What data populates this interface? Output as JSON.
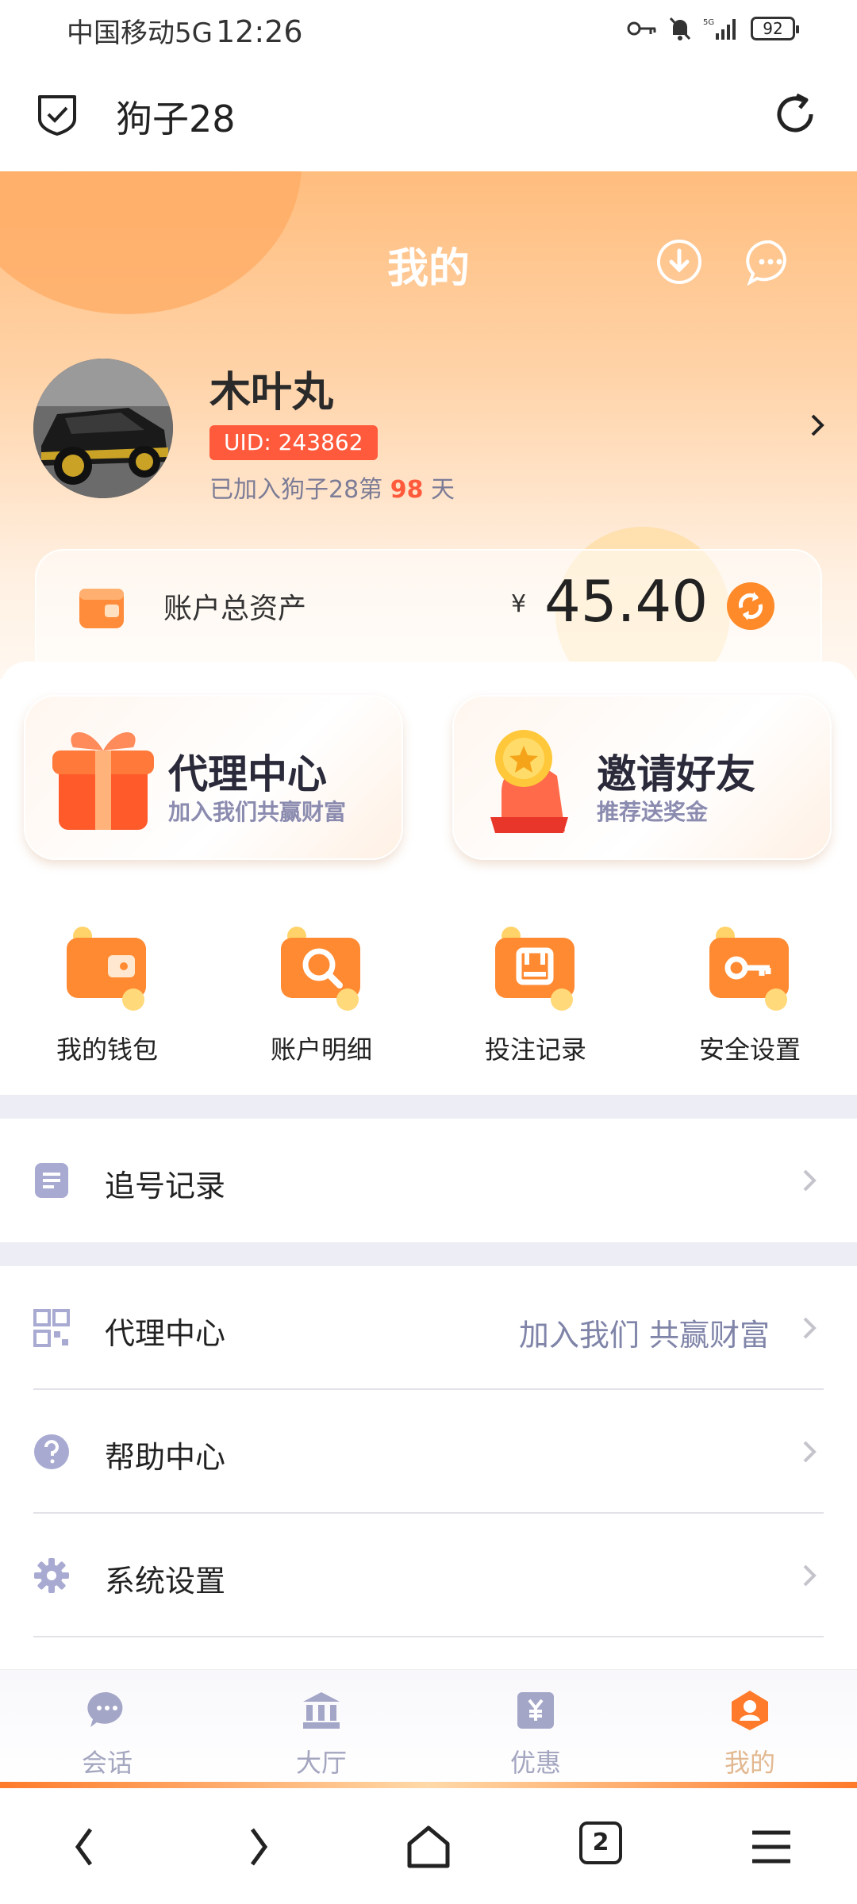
{
  "status_bar": {
    "carrier": "中国移动5G",
    "time": "12:26",
    "battery": "92"
  },
  "app_bar": {
    "title": "狗子28"
  },
  "header": {
    "title": "我的"
  },
  "profile": {
    "name": "木叶丸",
    "uid": "UID: 243862",
    "joined_prefix": "已加入狗子28第",
    "joined_days": "98",
    "joined_suffix": "天"
  },
  "assets": {
    "label": "账户总资产",
    "currency": "¥",
    "amount": "45.40"
  },
  "promos": [
    {
      "title": "代理中心",
      "subtitle": "加入我们共赢财富",
      "icon": "gift-box-icon"
    },
    {
      "title": "邀请好友",
      "subtitle": "推荐送奖金",
      "icon": "coin-hand-icon"
    }
  ],
  "quick_actions": [
    {
      "label": "我的钱包",
      "icon": "wallet-icon"
    },
    {
      "label": "账户明细",
      "icon": "magnifier-icon"
    },
    {
      "label": "投注记录",
      "icon": "record-icon"
    },
    {
      "label": "安全设置",
      "icon": "key-icon"
    }
  ],
  "menu": {
    "chase_records": {
      "label": "追号记录",
      "icon": "document-icon"
    },
    "agent_center": {
      "label": "代理中心",
      "extra": "加入我们 共赢财富",
      "icon": "qr-code-icon"
    },
    "help_center": {
      "label": "帮助中心",
      "icon": "question-icon"
    },
    "system_settings": {
      "label": "系统设置",
      "icon": "gear-icon"
    }
  },
  "tabbar": [
    {
      "label": "会话",
      "icon": "chat-bubble-icon",
      "active": false
    },
    {
      "label": "大厅",
      "icon": "hall-icon",
      "active": false
    },
    {
      "label": "优惠",
      "icon": "coupon-icon",
      "active": false
    },
    {
      "label": "我的",
      "icon": "user-icon",
      "active": true
    }
  ],
  "browser_nav": {
    "tabs_count": "2"
  },
  "colors": {
    "accent": "#ff7a2a",
    "uid_badge": "#ff5a3c",
    "muted": "#7f84a8"
  }
}
